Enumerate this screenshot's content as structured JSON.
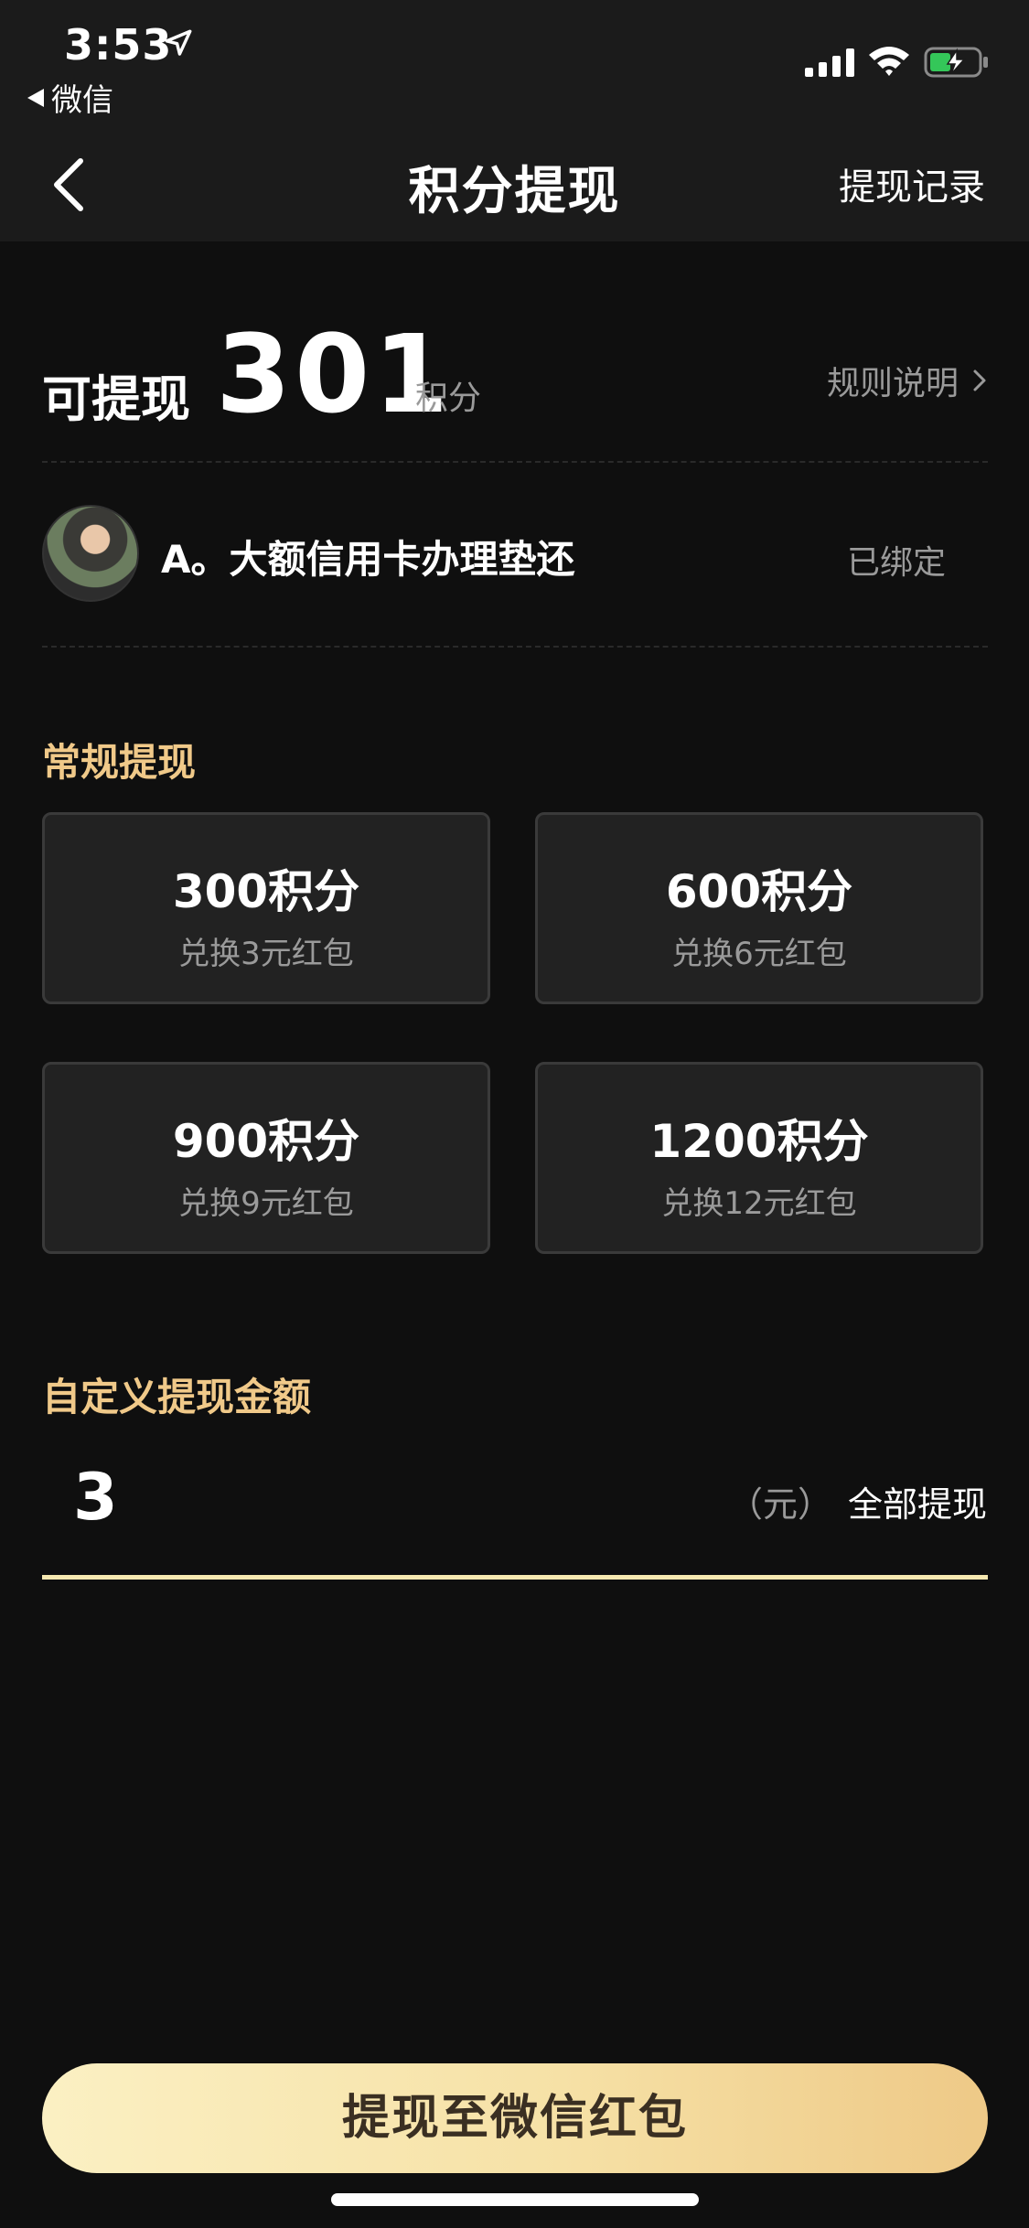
{
  "status_bar": {
    "time": "3:53",
    "back_app_label": "微信"
  },
  "nav": {
    "title": "积分提现",
    "record_label": "提现记录"
  },
  "balance": {
    "label": "可提现",
    "value": "301",
    "unit": "积分",
    "rules_label": "规则说明"
  },
  "account": {
    "name": "A。大额信用卡办理垫还",
    "status": "已绑定"
  },
  "regular": {
    "title": "常规提现",
    "options": [
      {
        "points": "300积分",
        "desc": "兑换3元红包"
      },
      {
        "points": "600积分",
        "desc": "兑换6元红包"
      },
      {
        "points": "900积分",
        "desc": "兑换9元红包"
      },
      {
        "points": "1200积分",
        "desc": "兑换12元红包"
      }
    ]
  },
  "custom": {
    "title": "自定义提现金额",
    "amount": "3",
    "unit": "（元）",
    "withdraw_all_label": "全部提现"
  },
  "submit": {
    "label": "提现至微信红包"
  },
  "colors": {
    "background": "#0f0f0f",
    "bar": "#1b1b1b",
    "accent_gold": "#f0c989",
    "card": "#222222",
    "battery_green": "#34c759"
  },
  "icons": {
    "location": "location-arrow-icon",
    "back": "chevron-left-icon",
    "signal": "cellular-signal-icon",
    "wifi": "wifi-icon",
    "battery": "battery-charging-icon",
    "rules": "chevron-right-icon"
  }
}
